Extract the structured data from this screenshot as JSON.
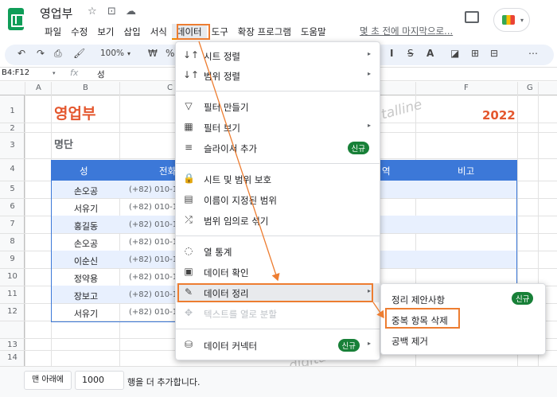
{
  "app": {
    "doc_title": "영업부",
    "last_edit": "몇 초 전에 마지막으로...",
    "meet_label": "▾"
  },
  "menubar": [
    "파일",
    "수정",
    "보기",
    "삽입",
    "서식",
    "데이터",
    "도구",
    "확장 프로그램",
    "도움말"
  ],
  "toolbar": {
    "undo": "↶",
    "redo": "↷",
    "print": "⎙",
    "paint": "🖌",
    "zoom": "100%",
    "zoom_caret": "▾",
    "currency": "₩",
    "percent": "%",
    "strike": "S",
    "fill": "◪",
    "borders": "⊞",
    "merge": "⊟",
    "more": "⋯"
  },
  "formula": {
    "namebox": "B4:F12",
    "namebox_caret": "▾",
    "fx": "fx",
    "value": "성"
  },
  "columns": [
    "A",
    "B",
    "C",
    "E",
    "F",
    "G"
  ],
  "rows": [
    "1",
    "2",
    "3",
    "4",
    "5",
    "6",
    "7",
    "8",
    "9",
    "10",
    "11",
    "12",
    "13",
    "14"
  ],
  "sheet": {
    "title": "영업부",
    "year": "2022",
    "subtitle": "명단",
    "headers": [
      "성",
      "전화",
      "역",
      "비고"
    ],
    "names": [
      "손오공",
      "서유기",
      "홍길동",
      "손오공",
      "이순신",
      "정약용",
      "장보고",
      "서유기"
    ],
    "phones": [
      "(+82) 010-12",
      "(+82) 010-12",
      "(+82) 010-12",
      "(+82) 010-12",
      "(+82) 010-12",
      "(+82) 010-12",
      "(+82) 010-12",
      "(+82) 010-12"
    ]
  },
  "footer": {
    "add_button": "맨 아래에",
    "rows_value": "1000",
    "suffix": "행을 더 추가합니다."
  },
  "data_menu": {
    "items": [
      {
        "icon": "↓↑",
        "label": "시트 정렬",
        "arrow": "▸"
      },
      {
        "icon": "↓↑",
        "label": "범위 정렬",
        "arrow": "▸"
      },
      {
        "icon": "▽",
        "label": "필터 만들기"
      },
      {
        "icon": "▦",
        "label": "필터 보기",
        "arrow": "▸"
      },
      {
        "icon": "≡",
        "label": "슬라이서 추가",
        "badge": "신규"
      },
      {
        "icon": "🔒",
        "label": "시트 및 범위 보호"
      },
      {
        "icon": "▤",
        "label": "이름이 지정된 범위"
      },
      {
        "icon": "⤮",
        "label": "범위 임의로 섞기"
      },
      {
        "icon": "◌",
        "label": "열 통계"
      },
      {
        "icon": "▣",
        "label": "데이터 확인"
      },
      {
        "icon": "✎",
        "label": "데이터 정리",
        "arrow": "▸"
      },
      {
        "icon": "✥",
        "label": "텍스트를 열로 분할"
      },
      {
        "icon": "⛁",
        "label": "데이터 커넥터",
        "badge": "신규",
        "arrow": "▸"
      }
    ]
  },
  "sub_menu": {
    "items": [
      {
        "label": "정리 제안사항",
        "badge": "신규"
      },
      {
        "label": "중복 항목 삭제"
      },
      {
        "label": "공백 제거"
      }
    ]
  },
  "watermark": "digitalline",
  "colors": {
    "accent": "#ed7d31",
    "header_blue": "#3c78d8",
    "title_orange": "#e4572e",
    "badge_green": "#188038"
  }
}
